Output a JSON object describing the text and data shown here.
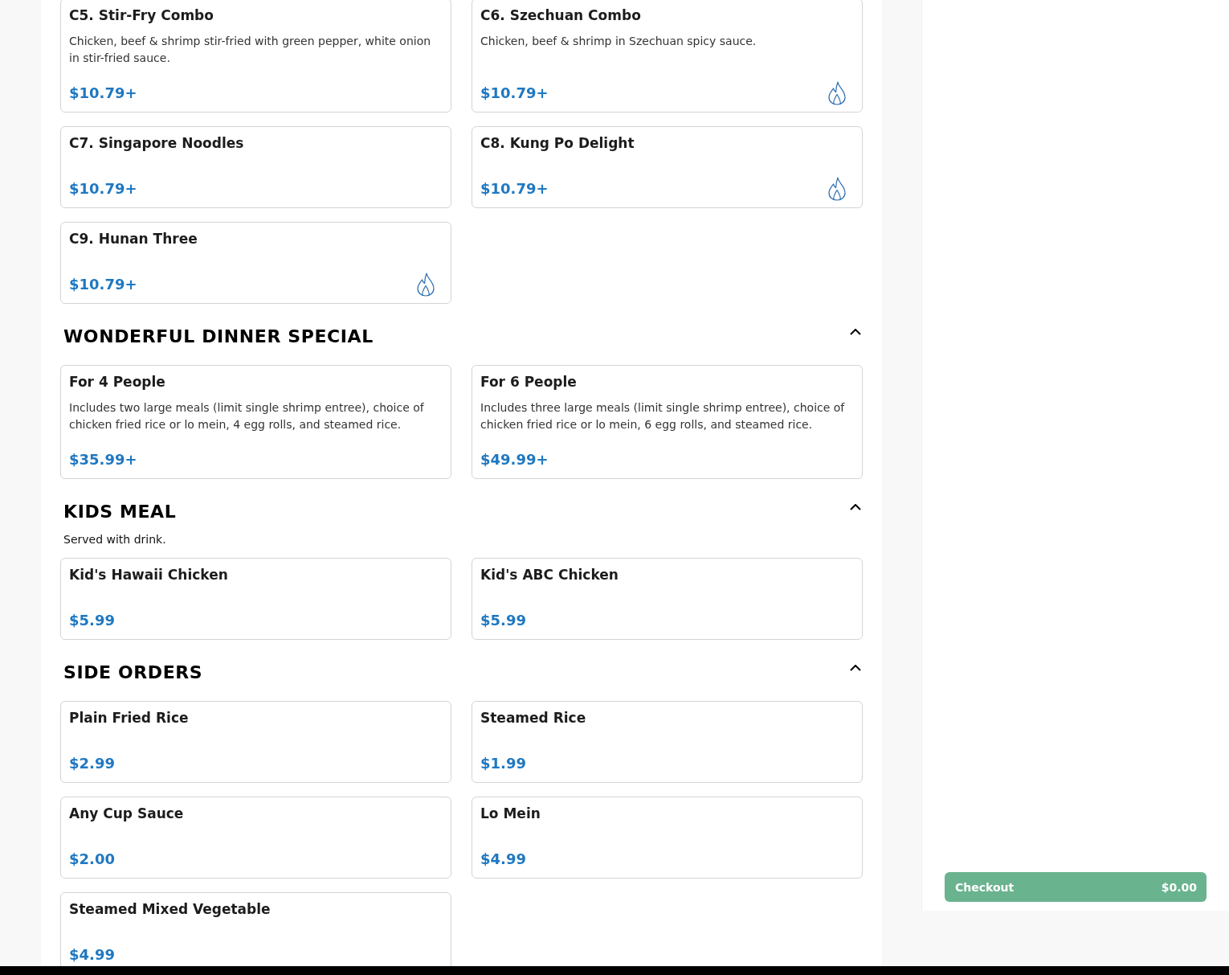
{
  "menu": {
    "sections": [
      {
        "items": [
          {
            "name": "C5. Stir-Fry Combo",
            "description": "Chicken, beef & shrimp stir-fried with green pepper, white onion in stir-fried sauce.",
            "price": "$10.79+",
            "spicy": false
          },
          {
            "name": "C6. Szechuan Combo",
            "description": "Chicken, beef & shrimp in Szechuan spicy sauce.",
            "price": "$10.79+",
            "spicy": true
          },
          {
            "name": "C7. Singapore Noodles",
            "price": "$10.79+",
            "spicy": false
          },
          {
            "name": "C8. Kung Po Delight",
            "price": "$10.79+",
            "spicy": true
          },
          {
            "name": "C9. Hunan Three",
            "price": "$10.79+",
            "spicy": true
          }
        ]
      },
      {
        "title": "WONDERFUL DINNER SPECIAL",
        "expanded": true,
        "items": [
          {
            "name": "For 4 People",
            "description": "Includes two large meals (limit single shrimp entree), choice of chicken fried rice or lo mein, 4 egg rolls, and steamed rice.",
            "price": "$35.99+",
            "spicy": false
          },
          {
            "name": "For 6 People",
            "description": "Includes three large meals (limit single shrimp entree), choice of chicken fried rice or lo mein, 6 egg rolls, and steamed rice.",
            "price": "$49.99+",
            "spicy": false
          }
        ]
      },
      {
        "title": "KIDS MEAL",
        "expanded": true,
        "note": "Served with drink.",
        "items": [
          {
            "name": "Kid's Hawaii Chicken",
            "price": "$5.99",
            "spicy": false
          },
          {
            "name": "Kid's ABC Chicken",
            "price": "$5.99",
            "spicy": false
          }
        ]
      },
      {
        "title": "SIDE ORDERS",
        "expanded": true,
        "items": [
          {
            "name": "Plain Fried Rice",
            "price": "$2.99",
            "spicy": false
          },
          {
            "name": "Steamed Rice",
            "price": "$1.99",
            "spicy": false
          },
          {
            "name": "Any Cup Sauce",
            "price": "$2.00",
            "spicy": false
          },
          {
            "name": "Lo Mein",
            "price": "$4.99",
            "spicy": false
          },
          {
            "name": "Steamed Mixed Vegetable",
            "price": "$4.99",
            "spicy": false
          }
        ]
      }
    ]
  },
  "cart": {
    "checkout_label": "Checkout",
    "total": "$0.00"
  }
}
